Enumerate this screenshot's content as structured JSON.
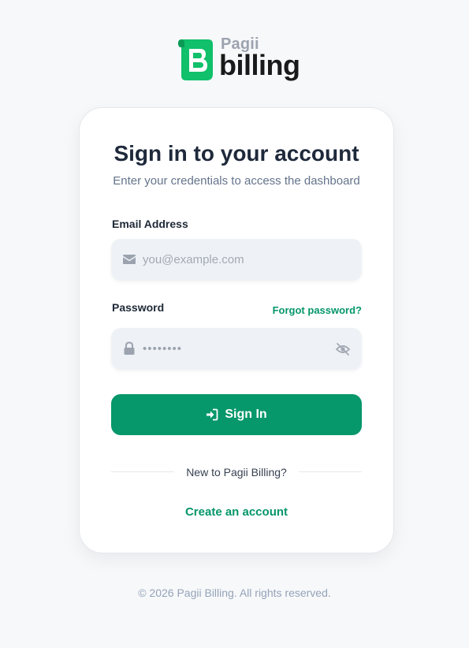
{
  "logo": {
    "brand_small": "Pagii",
    "brand_large": "billing",
    "icon": "scroll-b-logo-icon",
    "color": "#10b981"
  },
  "card": {
    "title": "Sign in to your account",
    "subtitle": "Enter your credentials to access the dashboard"
  },
  "email": {
    "label": "Email Address",
    "placeholder": "you@example.com",
    "value": "",
    "icon": "envelope-icon"
  },
  "password": {
    "label": "Password",
    "forgot_label": "Forgot password?",
    "value": "••••••••",
    "icon": "lock-icon",
    "toggle_icon": "eye-slash-icon"
  },
  "submit": {
    "label": "Sign In",
    "icon": "sign-in-icon",
    "color": "#06976a"
  },
  "divider": {
    "text": "New to Pagii Billing?"
  },
  "create_account": {
    "label": "Create an account"
  },
  "footer": {
    "text": "© 2026 Pagii Billing. All rights reserved."
  }
}
